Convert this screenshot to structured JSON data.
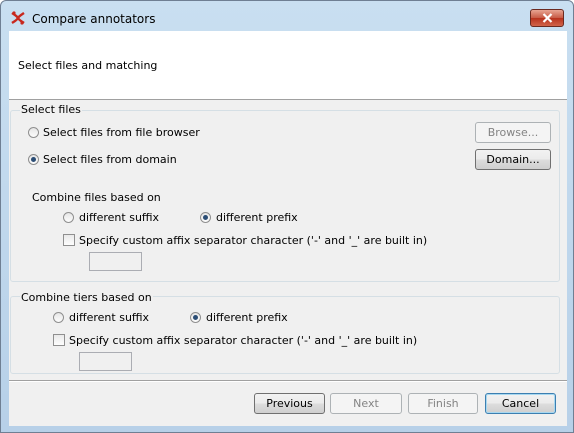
{
  "window": {
    "title": "Compare annotators"
  },
  "header": {
    "text": "Select files and matching"
  },
  "select_files": {
    "group_title": "Select files",
    "options": [
      {
        "label": "Select files from file browser",
        "checked": false
      },
      {
        "label": "Select files from domain",
        "checked": true
      }
    ],
    "browse_button": "Browse...",
    "domain_button": "Domain...",
    "combine_files": {
      "title": "Combine files based on",
      "suffix_label": "different suffix",
      "suffix_checked": false,
      "prefix_label": "different prefix",
      "prefix_checked": true,
      "custom_separator_label": "Specify custom affix separator character ('-' and '_' are built in)",
      "custom_separator_checked": false,
      "separator_value": ""
    }
  },
  "combine_tiers": {
    "group_title": "Combine tiers based on",
    "suffix_label": "different suffix",
    "suffix_checked": false,
    "prefix_label": "different prefix",
    "prefix_checked": true,
    "custom_separator_label": "Specify custom affix separator character ('-' and '_' are built in)",
    "custom_separator_checked": false,
    "separator_value": ""
  },
  "footer": {
    "previous": "Previous",
    "next": "Next",
    "finish": "Finish",
    "cancel": "Cancel"
  },
  "colors": {
    "title_bar": "#b7d0e8",
    "close_button": "#c75a44",
    "dialog_background": "#f0f0f0",
    "radio_dot": "#2b4d75",
    "default_button_border": "#3c7fb1"
  },
  "icons": {
    "app": "elan-app-icon",
    "close": "close-icon"
  }
}
